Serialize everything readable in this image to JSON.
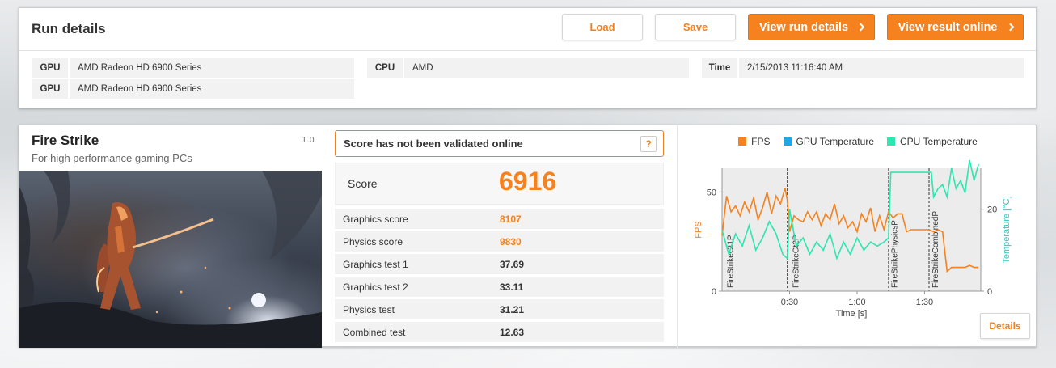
{
  "run": {
    "title": "Run details",
    "load_label": "Load",
    "save_label": "Save",
    "view_run_label": "View run details",
    "view_online_label": "View result online",
    "gpu_label": "GPU",
    "gpu1": "AMD Radeon HD 6900 Series",
    "gpu2": "AMD Radeon HD 6900 Series",
    "cpu_label": "CPU",
    "cpu": "AMD",
    "time_label": "Time",
    "time": "2/15/2013 11:16:40 AM"
  },
  "benchmark": {
    "title": "Fire Strike",
    "subtitle": "For high performance gaming PCs",
    "version": "1.0",
    "validation": "Score has not been validated online",
    "help": "?",
    "score_label": "Score",
    "score": "6916",
    "rows": [
      {
        "label": "Graphics score",
        "value": "8107"
      },
      {
        "label": "Physics score",
        "value": "9830"
      },
      {
        "label": "Graphics test 1",
        "value": "37.69"
      },
      {
        "label": "Graphics test 2",
        "value": "33.11"
      },
      {
        "label": "Physics test",
        "value": "31.21"
      },
      {
        "label": "Combined test",
        "value": "12.63"
      }
    ]
  },
  "chart_data": {
    "type": "line",
    "xlabel": "Time [s]",
    "ylabel": "FPS",
    "y2label": "Temperature [°C]",
    "xlim": [
      0,
      115
    ],
    "ylim": [
      0,
      62
    ],
    "y2lim": [
      0,
      30
    ],
    "xticks": [
      {
        "value": 30,
        "label": "0:30"
      },
      {
        "value": 60,
        "label": "1:00"
      },
      {
        "value": 90,
        "label": "1:30"
      }
    ],
    "yticks": [
      0,
      50
    ],
    "y2ticks": [
      0,
      20
    ],
    "grid": false,
    "legend": "top",
    "series_colors": {
      "fps": "#f5821f",
      "gpu": "#1ea7e8",
      "cpu": "#2ee6b0"
    },
    "series": [
      {
        "name": "FPS",
        "axis": "left",
        "x": [
          0,
          2,
          4,
          6,
          8,
          10,
          12,
          14,
          16,
          18,
          20,
          22,
          24,
          26,
          28,
          29,
          30,
          32,
          34,
          36,
          38,
          40,
          42,
          44,
          46,
          48,
          50,
          52,
          54,
          56,
          58,
          60,
          62,
          64,
          66,
          68,
          70,
          72,
          74,
          76,
          78,
          80,
          82,
          84,
          86,
          88,
          90,
          92,
          94,
          96,
          98,
          100,
          102,
          104,
          106,
          108,
          110,
          112,
          114
        ],
        "values": [
          28,
          48,
          40,
          43,
          38,
          45,
          40,
          47,
          36,
          42,
          50,
          39,
          48,
          44,
          52,
          46,
          30,
          38,
          36,
          35,
          40,
          36,
          40,
          33,
          39,
          36,
          44,
          34,
          38,
          32,
          35,
          30,
          39,
          35,
          42,
          30,
          38,
          31,
          40,
          37,
          39,
          39,
          30,
          31,
          31,
          31,
          31,
          31,
          30,
          31,
          30,
          10,
          12,
          12,
          12,
          12,
          13,
          12,
          12
        ]
      },
      {
        "name": "CPU Temperature",
        "axis": "right",
        "x": [
          0,
          3,
          6,
          9,
          12,
          15,
          18,
          21,
          24,
          27,
          29,
          30,
          33,
          36,
          39,
          42,
          45,
          48,
          51,
          54,
          57,
          60,
          63,
          66,
          69,
          72,
          74,
          75,
          78,
          81,
          84,
          87,
          90,
          93,
          94,
          96,
          98,
          100,
          102,
          104,
          106,
          108,
          110,
          112,
          114
        ],
        "values": [
          15,
          9,
          14,
          11,
          16,
          10,
          13,
          17,
          14,
          9,
          8,
          20,
          11,
          13,
          9,
          12,
          10,
          14,
          8,
          12,
          9,
          13,
          10,
          12,
          11,
          12,
          13,
          29,
          29,
          29,
          29,
          29,
          29,
          29,
          23,
          25,
          26,
          23,
          30,
          25,
          27,
          24,
          32,
          27,
          31
        ]
      }
    ]
  }
}
